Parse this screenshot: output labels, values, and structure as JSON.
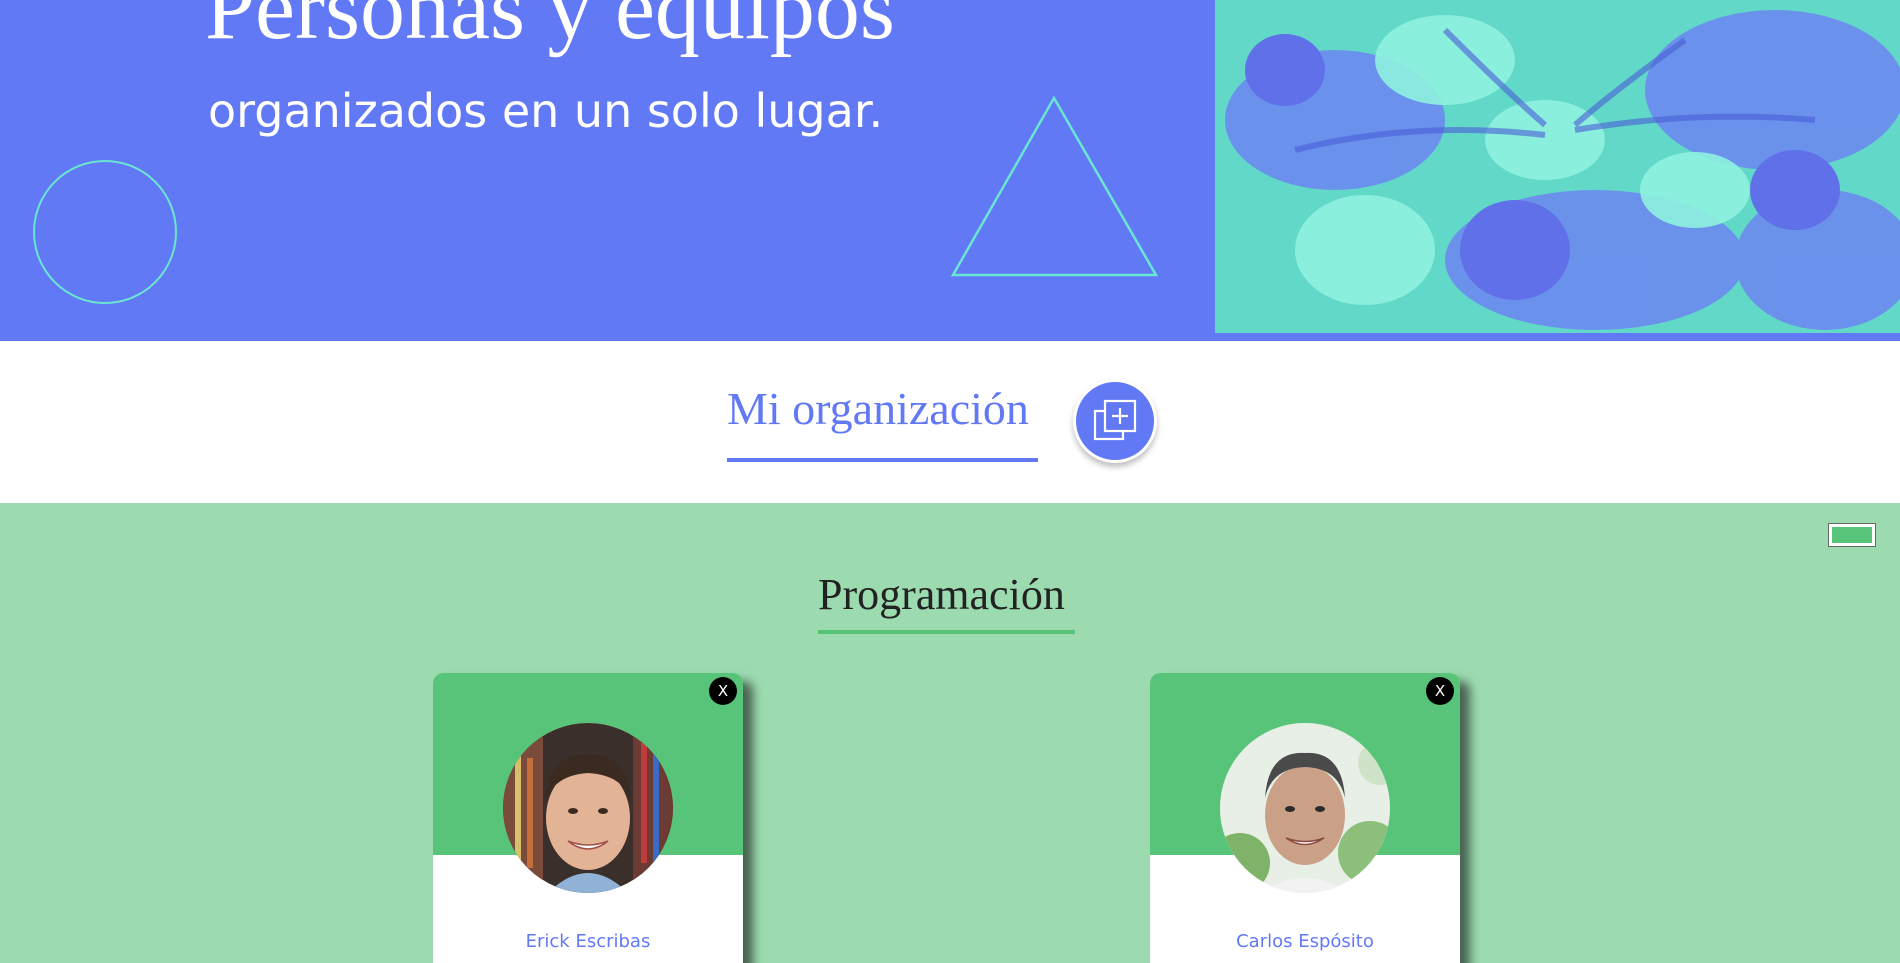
{
  "hero": {
    "title": "Personas y equipos",
    "subtitle": "organizados en un solo lugar."
  },
  "organization": {
    "title": "Mi organización"
  },
  "team": {
    "name": "Programación",
    "members": [
      {
        "name": "Erick Escribas",
        "remove_label": "X"
      },
      {
        "name": "Carlos Espósito",
        "remove_label": "X"
      }
    ]
  },
  "colors": {
    "primary": "#6279f6",
    "accent_teal": "#69e6d1",
    "team_background": "#9cdbb0",
    "team_accent": "#58c47a"
  },
  "icons": {
    "add_organization": "add-copy-icon"
  }
}
